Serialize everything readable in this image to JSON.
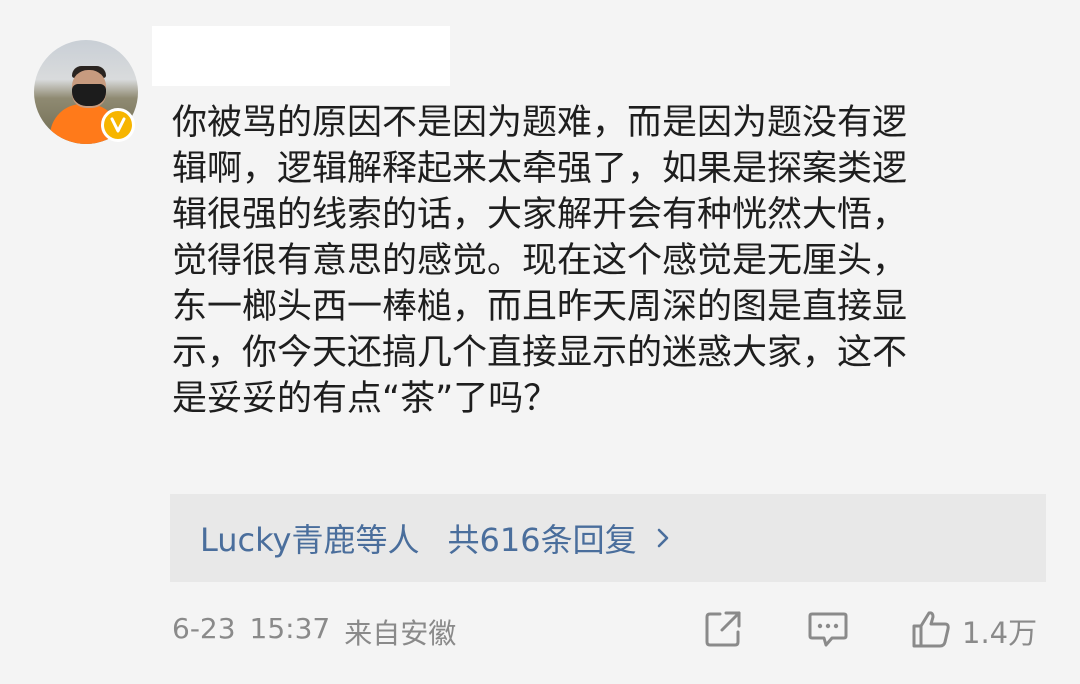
{
  "comment": {
    "lines": [
      "你被骂的原因不是因为题难，而是因为题没有逻",
      "辑啊，逻辑解释起来太牵强了，如果是探案类逻",
      "辑很强的线索的话，大家解开会有种恍然大悟，",
      "觉得很有意思的感觉。现在这个感觉是无厘头，",
      "东一榔头西一棒槌，而且昨天周深的图是直接显",
      "示，你今天还搞几个直接显示的迷惑大家，这不",
      "是妥妥的有点“茶”了吗？"
    ]
  },
  "replies": {
    "users": "Lucky青鹿",
    "suffix": "等人",
    "count": "共616条回复"
  },
  "meta": {
    "date": "6-23",
    "time": "15:37",
    "source": "来自安徽"
  },
  "actions": {
    "share_icon": "share-icon",
    "comment_icon": "comment-icon",
    "like_icon": "thumbs-up-icon",
    "like_count": "1.4万"
  },
  "colors": {
    "background": "#f4f4f4",
    "link": "#4a6e9c",
    "badge": "#f7b500",
    "meta": "#8a8a8a"
  }
}
